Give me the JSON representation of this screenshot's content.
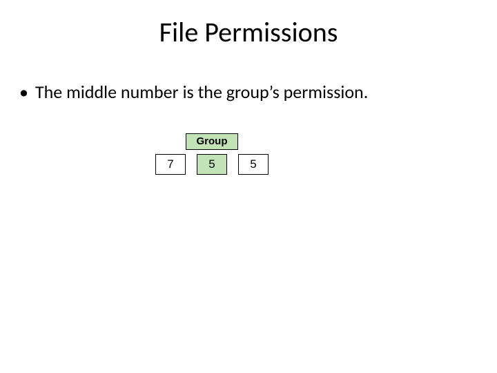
{
  "title": "File Permissions",
  "bullet": "The middle number is the group’s permission.",
  "diagram": {
    "label": "Group",
    "digits": [
      "7",
      "5",
      "5"
    ]
  }
}
